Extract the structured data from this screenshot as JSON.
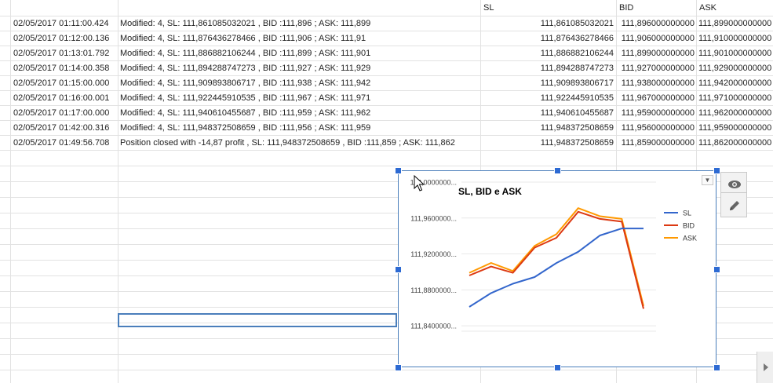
{
  "columns": {
    "sl": "SL",
    "bid": "BID",
    "ask": "ASK"
  },
  "rows": [
    {
      "time": "02/05/2017 01:11:00.424",
      "message": "Modified: 4, SL: 111,861085032021 , BID :111,896 ; ASK: 111,899",
      "sl": "111,861085032021",
      "bid": "111,896000000000",
      "ask": "111,899000000000"
    },
    {
      "time": "02/05/2017 01:12:00.136",
      "message": "Modified: 4, SL: 111,876436278466 , BID :111,906 ; ASK: 111,91",
      "sl": "111,876436278466",
      "bid": "111,906000000000",
      "ask": "111,910000000000"
    },
    {
      "time": "02/05/2017 01:13:01.792",
      "message": "Modified: 4, SL: 111,886882106244 , BID :111,899 ; ASK: 111,901",
      "sl": "111,886882106244",
      "bid": "111,899000000000",
      "ask": "111,901000000000"
    },
    {
      "time": "02/05/2017 01:14:00.358",
      "message": "Modified: 4, SL: 111,894288747273 , BID :111,927 ; ASK: 111,929",
      "sl": "111,894288747273",
      "bid": "111,927000000000",
      "ask": "111,929000000000"
    },
    {
      "time": "02/05/2017 01:15:00.000",
      "message": "Modified: 4, SL: 111,909893806717 , BID :111,938 ; ASK: 111,942",
      "sl": "111,909893806717",
      "bid": "111,938000000000",
      "ask": "111,942000000000"
    },
    {
      "time": "02/05/2017 01:16:00.001",
      "message": "Modified: 4, SL: 111,922445910535 , BID :111,967 ; ASK: 111,971",
      "sl": "111,922445910535",
      "bid": "111,967000000000",
      "ask": "111,971000000000"
    },
    {
      "time": "02/05/2017 01:17:00.000",
      "message": "Modified: 4, SL: 111,940610455687 , BID :111,959 ; ASK: 111,962",
      "sl": "111,940610455687",
      "bid": "111,959000000000",
      "ask": "111,962000000000"
    },
    {
      "time": "02/05/2017 01:42:00.316",
      "message": "Modified: 4, SL: 111,948372508659 , BID :111,956 ; ASK: 111,959",
      "sl": "111,948372508659",
      "bid": "111,956000000000",
      "ask": "111,959000000000"
    },
    {
      "time": "02/05/2017 01:49:56.708",
      "message": "Position closed with -14,87 profit , SL: 111,948372508659 , BID :111,859 ; ASK: 111,862",
      "sl": "111,948372508659",
      "bid": "111,859000000000",
      "ask": "111,862000000000"
    }
  ],
  "chart_data": {
    "type": "line",
    "title": "SL, BID e ASK",
    "ylim": [
      111.82,
      112.0
    ],
    "ytick_values": [
      112.0,
      111.96,
      111.92,
      111.88,
      111.84
    ],
    "ytick_labels": [
      "112,0000000...",
      "111,9600000...",
      "111,9200000...",
      "111,8800000...",
      "111,8400000..."
    ],
    "x": [
      1,
      2,
      3,
      4,
      5,
      6,
      7,
      8,
      9
    ],
    "legend": "right",
    "series": [
      {
        "name": "SL",
        "color": "#3366cc",
        "values": [
          111.861085032021,
          111.876436278466,
          111.886882106244,
          111.894288747273,
          111.909893806717,
          111.922445910535,
          111.940610455687,
          111.948372508659,
          111.948372508659
        ]
      },
      {
        "name": "BID",
        "color": "#dc3912",
        "values": [
          111.896,
          111.906,
          111.899,
          111.927,
          111.938,
          111.967,
          111.959,
          111.956,
          111.859
        ]
      },
      {
        "name": "ASK",
        "color": "#ff9900",
        "values": [
          111.899,
          111.91,
          111.901,
          111.929,
          111.942,
          111.971,
          111.962,
          111.959,
          111.862
        ]
      }
    ]
  },
  "icons": {
    "eye": "eye-icon",
    "edit": "pencil-icon",
    "chart_menu": "dropdown-arrow-icon",
    "scroll": "scroll-right-icon",
    "cursor": "mouse-cursor-icon"
  },
  "colors": {
    "selection": "#4a7ebb",
    "handle": "#2d6ad3"
  }
}
